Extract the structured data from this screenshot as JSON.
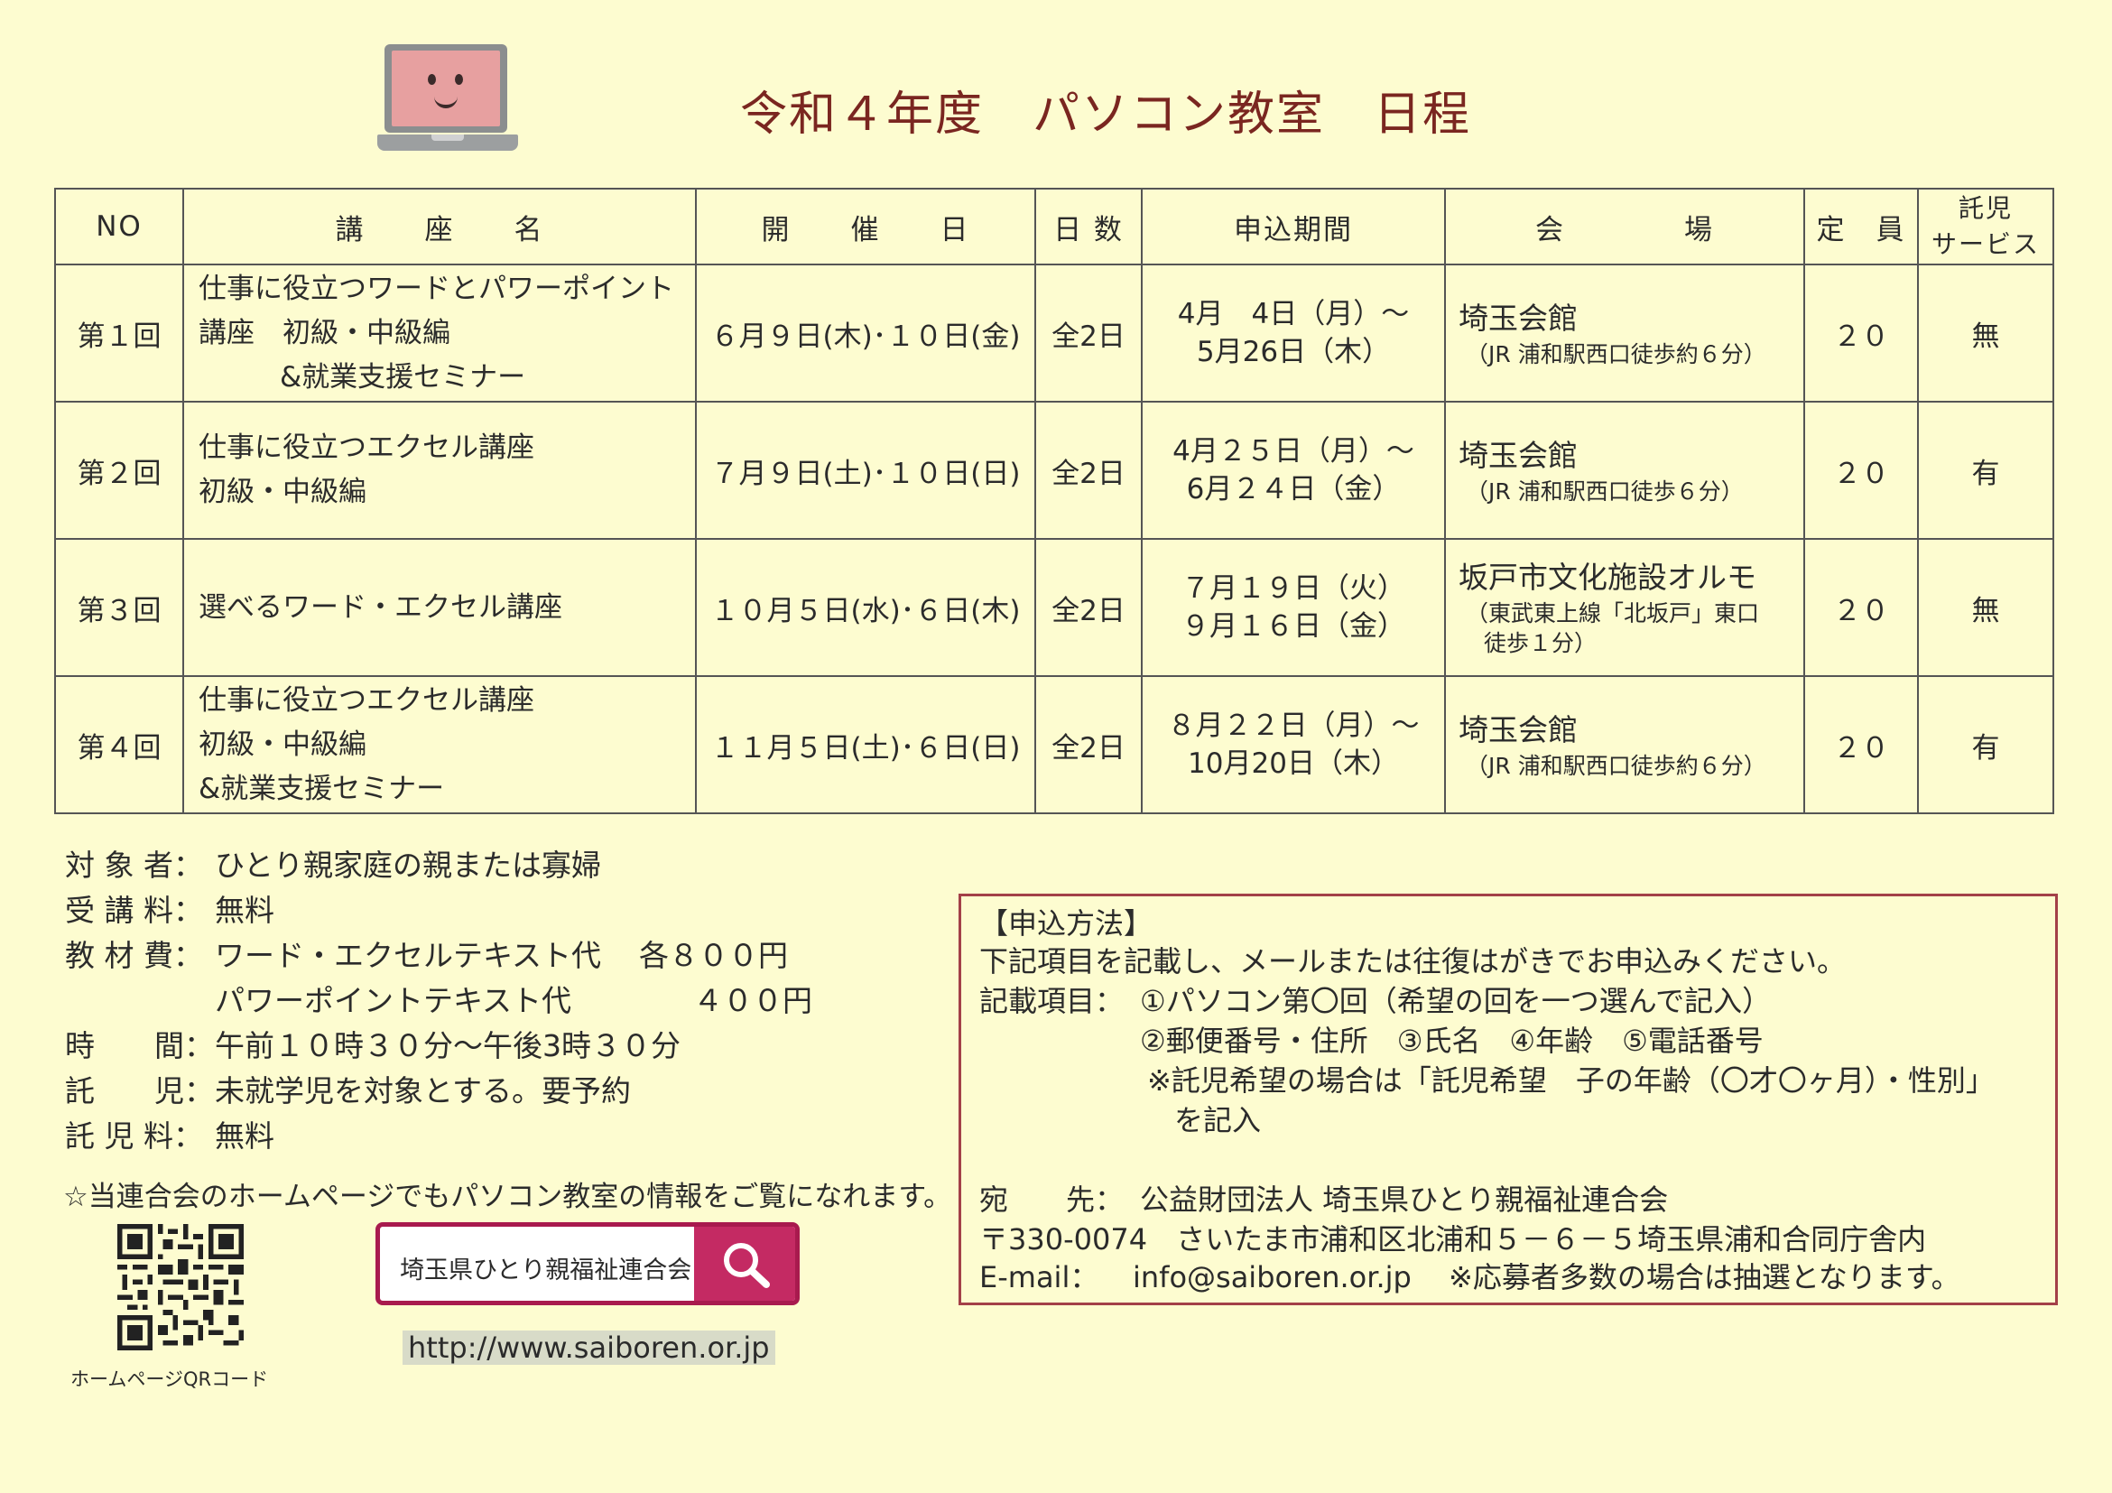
{
  "title": "令和４年度　パソコン教室　日程",
  "table": {
    "headers": {
      "no": "NO",
      "course": "講　　座　　名",
      "date": "開　　催　　日",
      "days": "日 数",
      "period": "申込期間",
      "venue": "会　　　　場",
      "capacity": "定　員",
      "childcare_1": "託児",
      "childcare_2": "サービス"
    },
    "rows": [
      {
        "no": "第１回",
        "course_1": "仕事に役立つワードとパワーポイント",
        "course_2": "講座　初級・中級編",
        "course_3": "&就業支援セミナー",
        "date": "６月９日(木)･１０日(金)",
        "days": "全2日",
        "period_1": "4月　4日（月）～",
        "period_2": "5月26日（木）",
        "venue_1": "埼玉会館",
        "venue_2": "（JR 浦和駅西口徒歩約６分）",
        "venue_3": "",
        "capacity": "２０",
        "childcare": "無"
      },
      {
        "no": "第２回",
        "course_1": "仕事に役立つエクセル講座",
        "course_2": "初級・中級編",
        "course_3": "",
        "date": "７月９日(土)･１０日(日)",
        "days": "全2日",
        "period_1": "4月２５日（月）～",
        "period_2": "6月２４日（金）",
        "venue_1": "埼玉会館",
        "venue_2": "（JR 浦和駅西口徒歩６分）",
        "venue_3": "",
        "capacity": "２０",
        "childcare": "有"
      },
      {
        "no": "第３回",
        "course_1": "選べるワード・エクセル講座",
        "course_2": "",
        "course_3": "",
        "date": "１０月５日(水)･６日(木)",
        "days": "全2日",
        "period_1": "７月１９日（火）",
        "period_2": "９月１６日（金）",
        "venue_1": "坂戸市文化施設オルモ",
        "venue_2": "（東武東上線「北坂戸」東口",
        "venue_3": "徒歩１分）",
        "capacity": "２０",
        "childcare": "無"
      },
      {
        "no": "第４回",
        "course_1": "仕事に役立つエクセル講座",
        "course_2": "初級・中級編",
        "course_3": "&就業支援セミナー",
        "date": "１１月５日(土)･６日(日)",
        "days": "全2日",
        "period_1": "８月２２日（月）～",
        "period_2": "10月20日（木）",
        "venue_1": "埼玉会館",
        "venue_2": "（JR 浦和駅西口徒歩約６分）",
        "venue_3": "",
        "capacity": "２０",
        "childcare": "有"
      }
    ]
  },
  "info": {
    "target_label": "対 象 者：",
    "target": "ひとり親家庭の親または寡婦",
    "fee_label": "受 講 料：",
    "fee": "無料",
    "material_label": "教 材 費：",
    "material_1": "ワード・エクセルテキスト代",
    "material_1_price": "各８００円",
    "material_2": "パワーポイントテキスト代",
    "material_2_price": "４００円",
    "time_label": "時　　間：",
    "time": "午前１０時３０分～午後3時３０分",
    "childcare_label": "託　　児：",
    "childcare": "未就学児を対象とする。要予約",
    "childcare_fee_label": "託 児 料：",
    "childcare_fee": "無料"
  },
  "homepage_note": "☆当連合会のホームページでもパソコン教室の情報をご覧になれます。",
  "qr_label": "ホームページQRコード",
  "search_text": "埼玉県ひとり親福祉連合会",
  "url": "http://www.saiboren.or.jp",
  "apply": {
    "heading": "【申込方法】",
    "line1": "下記項目を記載し、メールまたは往復はがきでお申込みください。",
    "items_label": "記載項目：",
    "item1": "①パソコン第〇回（希望の回を一つ選んで記入）",
    "item2": "②郵便番号・住所　③氏名　④年齢　⑤電話番号",
    "note1": "※託児希望の場合は「託児希望　子の年齢（〇才〇ヶ月）・性別」",
    "note2": "を記入",
    "to_label": "宛　　先：",
    "to": "公益財団法人 埼玉県ひとり親福祉連合会",
    "address": "〒330-0074　さいたま市浦和区北浦和５－６－５埼玉県浦和合同庁舎内",
    "email_label": "E-mail：",
    "email": "info@saiboren.or.jp",
    "lottery": "※応募者多数の場合は抽選となります。"
  },
  "colors": {
    "background": "#fdfcd0",
    "title": "#7a2620",
    "search_accent": "#c42a63",
    "apply_border": "#a34048"
  }
}
